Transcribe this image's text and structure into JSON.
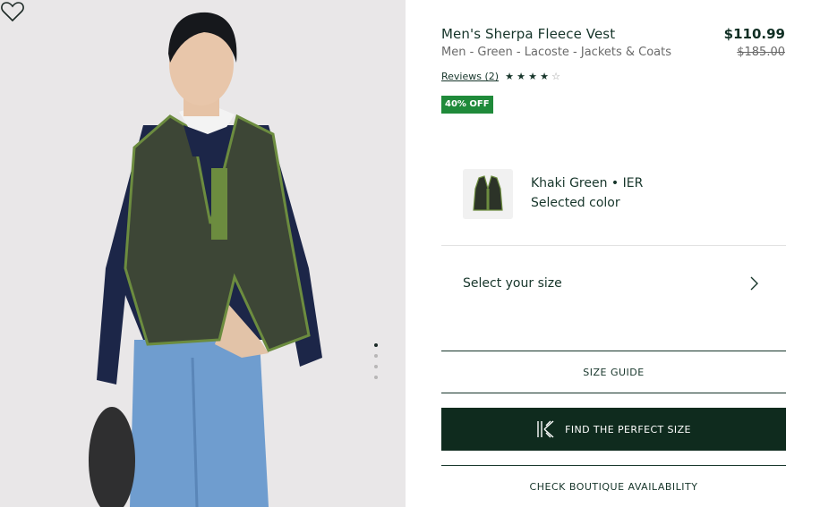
{
  "product": {
    "title": "Men's Sherpa Fleece Vest",
    "breadcrumb": "Men - Green - Lacoste - Jackets & Coats",
    "price": "$110.99",
    "original_price": "$185.00",
    "reviews_label": "Reviews (2)",
    "rating": 4,
    "rating_max": 5,
    "discount_badge": "40% OFF"
  },
  "color": {
    "name": "Khaki Green • IER",
    "label": "Selected color"
  },
  "size": {
    "label": "Select your size"
  },
  "actions": {
    "size_guide": "SIZE GUIDE",
    "find_size": "FIND THE PERFECT SIZE",
    "boutique": "CHECK BOUTIQUE AVAILABILITY"
  },
  "gallery": {
    "total_images": 4,
    "active_index": 0
  },
  "colors": {
    "brand_dark": "#0f2b1e",
    "text": "#16352a",
    "discount": "#1f8a3a"
  },
  "icons": {
    "wishlist": "heart-icon",
    "size_chevron": "chevron-right-icon",
    "find_size": "kiwi-sizing-logo-icon"
  }
}
